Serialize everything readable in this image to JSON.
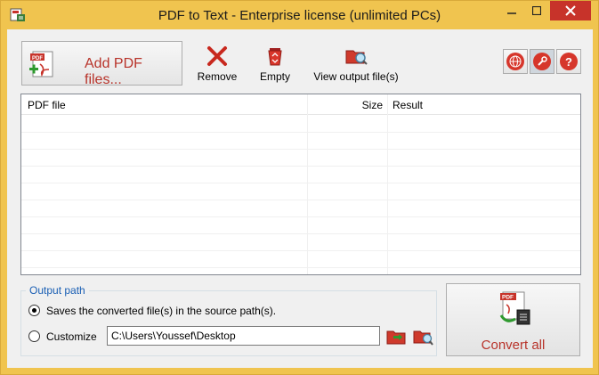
{
  "window": {
    "title": "PDF to Text - Enterprise license (unlimited PCs)"
  },
  "toolbar": {
    "add_label": "Add PDF files...",
    "add_icon_text": "PDF",
    "remove_label": "Remove",
    "empty_label": "Empty",
    "view_label": "View output file(s)"
  },
  "grid": {
    "columns": [
      "PDF file",
      "Size",
      "Result"
    ],
    "rows": []
  },
  "output": {
    "group_label": "Output path",
    "option_source_label": "Saves the converted file(s) in the source path(s).",
    "option_customize_label": "Customize",
    "path_value": "C:\\Users\\Youssef\\Desktop",
    "selected_option": "source"
  },
  "convert": {
    "label": "Convert all",
    "icon_text": "PDF"
  },
  "colors": {
    "frame": "#f0c44f",
    "accent_red": "#b8332a",
    "close_red": "#c7332a",
    "group_blue": "#1a5fb4"
  },
  "icons": [
    "app-icon",
    "minimize-icon",
    "maximize-icon",
    "close-icon",
    "add-pdf-icon",
    "remove-x-icon",
    "recycle-bin-icon",
    "folder-view-icon",
    "globe-icon",
    "wrench-icon",
    "help-icon",
    "folder-icon",
    "folder-view-icon",
    "pdf-convert-icon"
  ]
}
